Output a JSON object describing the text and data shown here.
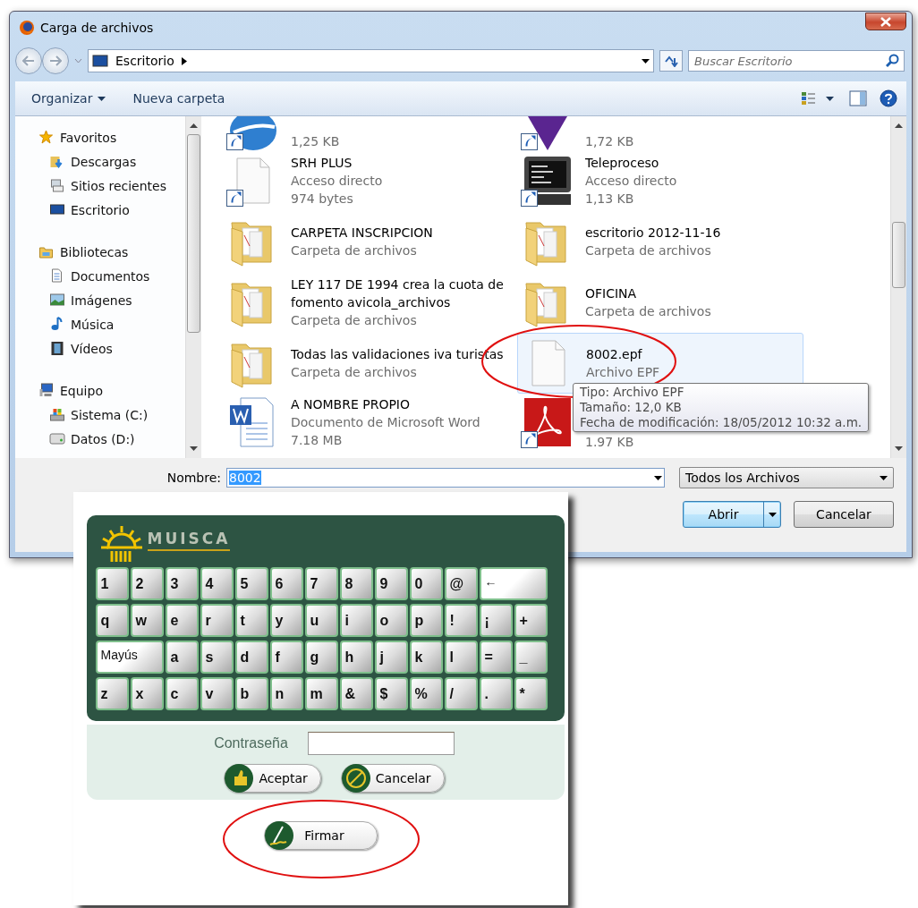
{
  "window": {
    "title": "Carga de archivos"
  },
  "address_bar": {
    "location": "Escritorio"
  },
  "search": {
    "placeholder": "Buscar Escritorio"
  },
  "toolbar": {
    "buttons": [
      {
        "label": "Organizar",
        "kind": "menu"
      },
      {
        "label": "Nueva carpeta",
        "kind": "plain"
      }
    ]
  },
  "sidebar": {
    "groups": [
      {
        "label": "Favoritos",
        "kind": "star",
        "children": [
          {
            "label": "Descargas",
            "kind": "downloads"
          },
          {
            "label": "Sitios recientes",
            "kind": "recent"
          },
          {
            "label": "Escritorio",
            "kind": "desktop"
          }
        ]
      },
      {
        "label": "Bibliotecas",
        "kind": "library",
        "children": [
          {
            "label": "Documentos",
            "kind": "document"
          },
          {
            "label": "Imágenes",
            "kind": "pictures"
          },
          {
            "label": "Música",
            "kind": "music"
          },
          {
            "label": "Vídeos",
            "kind": "video"
          }
        ]
      },
      {
        "label": "Equipo",
        "kind": "computer",
        "children": [
          {
            "label": "Sistema (C:)",
            "kind": "system-drive"
          },
          {
            "label": "Datos (D:)",
            "kind": "drive"
          }
        ]
      }
    ]
  },
  "files": [
    {
      "kind": "globe",
      "shortcut": true,
      "size": "1,25 KB",
      "selected": false
    },
    {
      "kind": "funnel",
      "shortcut": true,
      "size": "1,72 KB",
      "selected": false
    },
    {
      "kind": "blank",
      "shortcut": true,
      "name": "SRH PLUS",
      "type": "Acceso directo",
      "size": "974 bytes",
      "selected": false
    },
    {
      "kind": "terminal",
      "shortcut": true,
      "name": "Teleproceso",
      "type": "Acceso directo",
      "size": "1,13 KB",
      "selected": false
    },
    {
      "kind": "folder",
      "shortcut": false,
      "name": "CARPETA INSCRIPCION",
      "type": "Carpeta de archivos",
      "selected": false
    },
    {
      "kind": "folder",
      "shortcut": false,
      "name": "escritorio 2012-11-16",
      "type": "Carpeta de archivos",
      "selected": false
    },
    {
      "kind": "folder",
      "shortcut": false,
      "name": "LEY 117 DE 1994 crea la cuota de fomento avicola_archivos",
      "type": "Carpeta de archivos",
      "selected": false
    },
    {
      "kind": "folder",
      "shortcut": false,
      "name": "OFICINA",
      "type": "Carpeta de archivos",
      "selected": false
    },
    {
      "kind": "folder",
      "shortcut": false,
      "name": "Todas las validaciones iva turistas",
      "type": "Carpeta de archivos",
      "selected": false
    },
    {
      "kind": "blank",
      "shortcut": false,
      "name": "8002.epf",
      "type": "Archivo EPF",
      "selected": true
    },
    {
      "kind": "word",
      "shortcut": false,
      "name": "A NOMBRE PROPIO",
      "type": "Documento de Microsoft Word",
      "size": "7.18 MB",
      "selected": false
    },
    {
      "kind": "pdf",
      "shortcut": true,
      "size": "1.97 KB",
      "selected": false
    }
  ],
  "tooltip": {
    "lines": [
      "Tipo: Archivo EPF",
      "Tamaño: 12,0 KB",
      "Fecha de modificación: 18/05/2012 10:32 a.m."
    ]
  },
  "filename": {
    "label": "Nombre:",
    "value": "8002",
    "text_selected": true
  },
  "filter": {
    "value": "Todos los Archivos"
  },
  "buttons": [
    {
      "label": "Abrir",
      "kind": "split"
    },
    {
      "label": "Cancelar",
      "kind": "plain"
    }
  ],
  "keyboard_panel": {
    "logo": "MUISCA",
    "rows": [
      [
        {
          "label": "1",
          "kind": "char"
        },
        {
          "label": "2",
          "kind": "char"
        },
        {
          "label": "3",
          "kind": "char"
        },
        {
          "label": "4",
          "kind": "char"
        },
        {
          "label": "5",
          "kind": "char"
        },
        {
          "label": "6",
          "kind": "char"
        },
        {
          "label": "7",
          "kind": "char"
        },
        {
          "label": "8",
          "kind": "char"
        },
        {
          "label": "9",
          "kind": "char"
        },
        {
          "label": "0",
          "kind": "char"
        },
        {
          "label": "@",
          "kind": "char"
        },
        {
          "label": "←",
          "kind": "wide",
          "colspan": 2
        }
      ],
      [
        {
          "label": "q",
          "kind": "char"
        },
        {
          "label": "w",
          "kind": "char"
        },
        {
          "label": "e",
          "kind": "char"
        },
        {
          "label": "r",
          "kind": "char"
        },
        {
          "label": "t",
          "kind": "char"
        },
        {
          "label": "y",
          "kind": "char"
        },
        {
          "label": "u",
          "kind": "char"
        },
        {
          "label": "i",
          "kind": "char"
        },
        {
          "label": "o",
          "kind": "char"
        },
        {
          "label": "p",
          "kind": "char"
        },
        {
          "label": "!",
          "kind": "char"
        },
        {
          "label": "¡",
          "kind": "char"
        },
        {
          "label": "+",
          "kind": "char"
        }
      ],
      [
        {
          "label": "Mayús",
          "kind": "wide",
          "colspan": 2
        },
        {
          "label": "a",
          "kind": "char"
        },
        {
          "label": "s",
          "kind": "char"
        },
        {
          "label": "d",
          "kind": "char"
        },
        {
          "label": "f",
          "kind": "char"
        },
        {
          "label": "g",
          "kind": "char"
        },
        {
          "label": "h",
          "kind": "char"
        },
        {
          "label": "j",
          "kind": "char"
        },
        {
          "label": "k",
          "kind": "char"
        },
        {
          "label": "l",
          "kind": "char"
        },
        {
          "label": "=",
          "kind": "char"
        },
        {
          "label": "_",
          "kind": "char"
        }
      ],
      [
        {
          "label": "z",
          "kind": "char"
        },
        {
          "label": "x",
          "kind": "char"
        },
        {
          "label": "c",
          "kind": "char"
        },
        {
          "label": "v",
          "kind": "char"
        },
        {
          "label": "b",
          "kind": "char"
        },
        {
          "label": "n",
          "kind": "char"
        },
        {
          "label": "m",
          "kind": "char"
        },
        {
          "label": "&",
          "kind": "char"
        },
        {
          "label": "$",
          "kind": "char"
        },
        {
          "label": "%",
          "kind": "char"
        },
        {
          "label": "/",
          "kind": "char"
        },
        {
          "label": ".",
          "kind": "char"
        },
        {
          "label": "*",
          "kind": "char"
        }
      ]
    ],
    "password": {
      "label": "Contraseña"
    },
    "buttons": [
      {
        "label": "Aceptar",
        "kind": "thumb"
      },
      {
        "label": "Cancelar",
        "kind": "cancel"
      }
    ],
    "sign_button": {
      "label": "Firmar",
      "kind": "pen"
    }
  }
}
